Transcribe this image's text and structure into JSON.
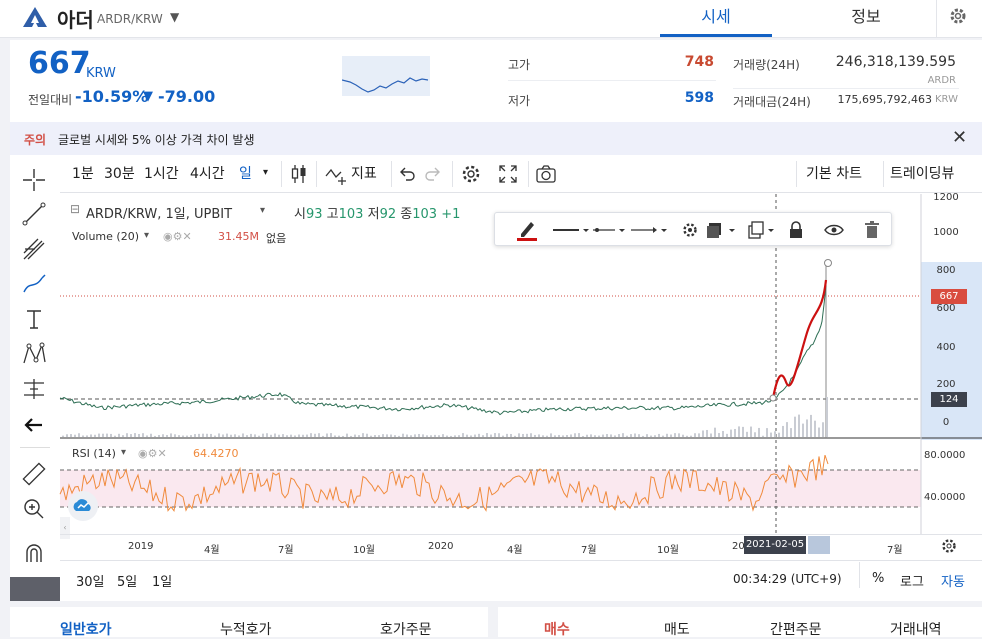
{
  "header": {
    "coin_name": "아더",
    "pair": "ARDR/KRW",
    "tabs": [
      "시세",
      "정보"
    ]
  },
  "price": {
    "value": "667",
    "unit": "KRW",
    "change_label": "전일대비",
    "change_pct": "-10.59%",
    "change_arrow": "▼",
    "change_val": "-79.00"
  },
  "stats": {
    "high_label": "고가",
    "high": "748",
    "low_label": "저가",
    "low": "598",
    "vol_label": "거래량(24H)",
    "vol": "246,318,139.595",
    "vol_unit": "ARDR",
    "amt_label": "거래대금(24H)",
    "amt": "175,695,792,463",
    "amt_unit": "KRW"
  },
  "notice": {
    "tag": "주의",
    "text": "글로벌 시세와 5% 이상 가격 차이 발생"
  },
  "toolbar": {
    "intervals": [
      "1분",
      "30분",
      "1시간",
      "4시간",
      "일"
    ],
    "indicators": "지표",
    "basic_chart": "기본 차트",
    "trading_view": "트레이딩뷰"
  },
  "legend": {
    "symbol": "ARDR/KRW, 1일, UPBIT",
    "o_label": "시",
    "o": "93",
    "h_label": "고",
    "h": "103",
    "l_label": "저",
    "l": "92",
    "c_label": "종",
    "c": "103",
    "c_tail": "+1",
    "volume": "Volume (20)",
    "vol_val": "31.45M",
    "vol_tail": "없음",
    "rsi": "RSI (14)",
    "rsi_val": "64.4270"
  },
  "price_axis": [
    "1200",
    "1000",
    "800",
    "600",
    "400",
    "200",
    "0"
  ],
  "price_tags": {
    "current": "667",
    "marker": "124"
  },
  "rsi_axis": [
    "80.0000",
    "40.0000"
  ],
  "time_axis": [
    "2019",
    "4월",
    "7월",
    "10월",
    "2020",
    "4월",
    "7월",
    "10월",
    "20",
    "4월",
    "7월"
  ],
  "crosshair_date": "2021-02-05",
  "bottom": {
    "ranges": [
      "30일",
      "5일",
      "1일"
    ],
    "clock": "00:34:29 (UTC+9)",
    "pct": "%",
    "log": "로그",
    "auto": "자동"
  },
  "order_tabs": [
    "일반호가",
    "누적호가",
    "호가주문"
  ],
  "trade_tabs": [
    "매수",
    "매도",
    "간편주문",
    "거래내역"
  ],
  "colors": {
    "accent": "#1261c4",
    "up": "#c84a31",
    "down": "#1261c4",
    "price_line": "#d24f45",
    "rsi": "#f08a3c",
    "drawing": "#cc1111"
  }
}
